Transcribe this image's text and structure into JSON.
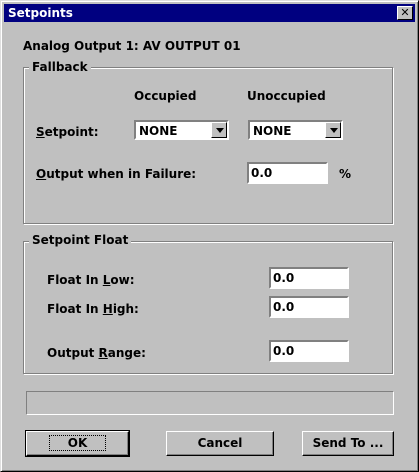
{
  "window": {
    "title": "Setpoints",
    "close_glyph": "✕"
  },
  "header": "Analog Output 1: AV OUTPUT 01",
  "fallback": {
    "title": "Fallback",
    "col_occupied": "Occupied",
    "col_unoccupied": "Unoccupied",
    "setpoint_label": "Setpoint:",
    "occupied_value": "NONE",
    "unoccupied_value": "NONE",
    "failure_label": "Output when in Failure:",
    "failure_value": "0.0",
    "failure_unit": "%"
  },
  "float": {
    "title": "Setpoint Float",
    "low_label": "Float In Low:",
    "low_value": "0.0",
    "high_label": "Float In High:",
    "high_value": "0.0",
    "range_label": "Output Range:",
    "range_value": "0.0"
  },
  "status_text": "",
  "buttons": {
    "ok": "OK",
    "cancel": "Cancel",
    "send": "Send To ..."
  }
}
